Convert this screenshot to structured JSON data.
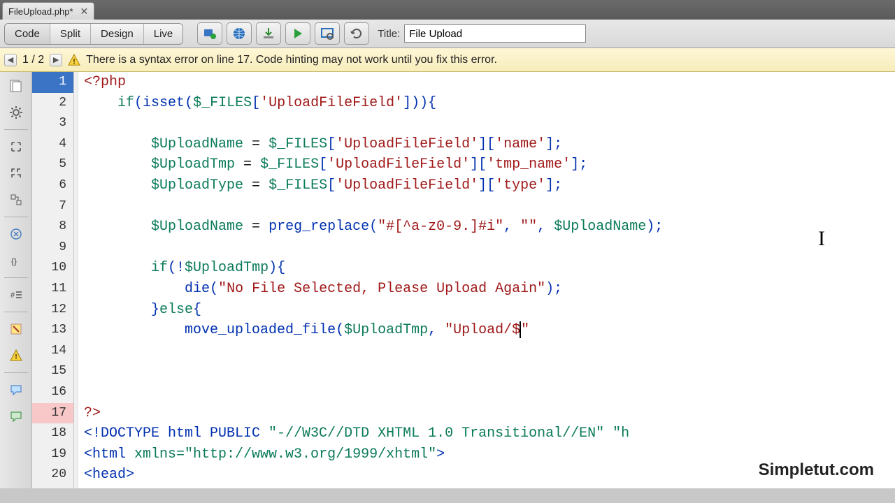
{
  "tab": {
    "label": "FileUpload.php*"
  },
  "viewButtons": {
    "code": "Code",
    "split": "Split",
    "design": "Design",
    "live": "Live"
  },
  "titleLabel": "Title:",
  "titleValue": "File Upload",
  "warn": {
    "counter": "1 / 2",
    "message": "There is a syntax error on line 17.  Code hinting may not work until you fix this error."
  },
  "lines": [
    1,
    2,
    3,
    4,
    5,
    6,
    7,
    8,
    9,
    10,
    11,
    12,
    13,
    14,
    15,
    16,
    17,
    18,
    19,
    20
  ],
  "currentLine": 1,
  "errorLine": 17,
  "code": {
    "l1": "<?php",
    "l2_if": "if",
    "l2_isset": "isset",
    "l2_files": "$_FILES",
    "l2_str": "'UploadFileField'",
    "l4_var": "$UploadName",
    "l4_files": "$_FILES",
    "l4_s1": "'UploadFileField'",
    "l4_s2": "'name'",
    "l5_var": "$UploadTmp",
    "l5_files": "$_FILES",
    "l5_s1": "'UploadFileField'",
    "l5_s2": "'tmp_name'",
    "l6_var": "$UploadType",
    "l6_files": "$_FILES",
    "l6_s1": "'UploadFileField'",
    "l6_s2": "'type'",
    "l8_var": "$UploadName",
    "l8_fn": "preg_replace",
    "l8_s1": "\"#[^a-z0-9.]#i\"",
    "l8_s2": "\"\"",
    "l8_v2": "$UploadName",
    "l10_if": "if",
    "l10_v": "$UploadTmp",
    "l11_fn": "die",
    "l11_s": "\"No File Selected, Please Upload Again\"",
    "l12_else": "else",
    "l13_fn": "move_uploaded_file",
    "l13_v": "$UploadTmp",
    "l13_s": "\"Upload/$",
    "l13_s2": "\"",
    "l17": "?>",
    "l18a": "<!DOCTYPE html PUBLIC ",
    "l18b": "\"-//W3C//DTD XHTML 1.0 Transitional//EN\"",
    "l18c": " \"h",
    "l19a": "<html ",
    "l19attr": "xmlns=",
    "l19b": "\"http://www.w3.org/1999/xhtml\"",
    "l19c": ">",
    "l20": "<head>"
  },
  "watermark": "Simpletut.com"
}
